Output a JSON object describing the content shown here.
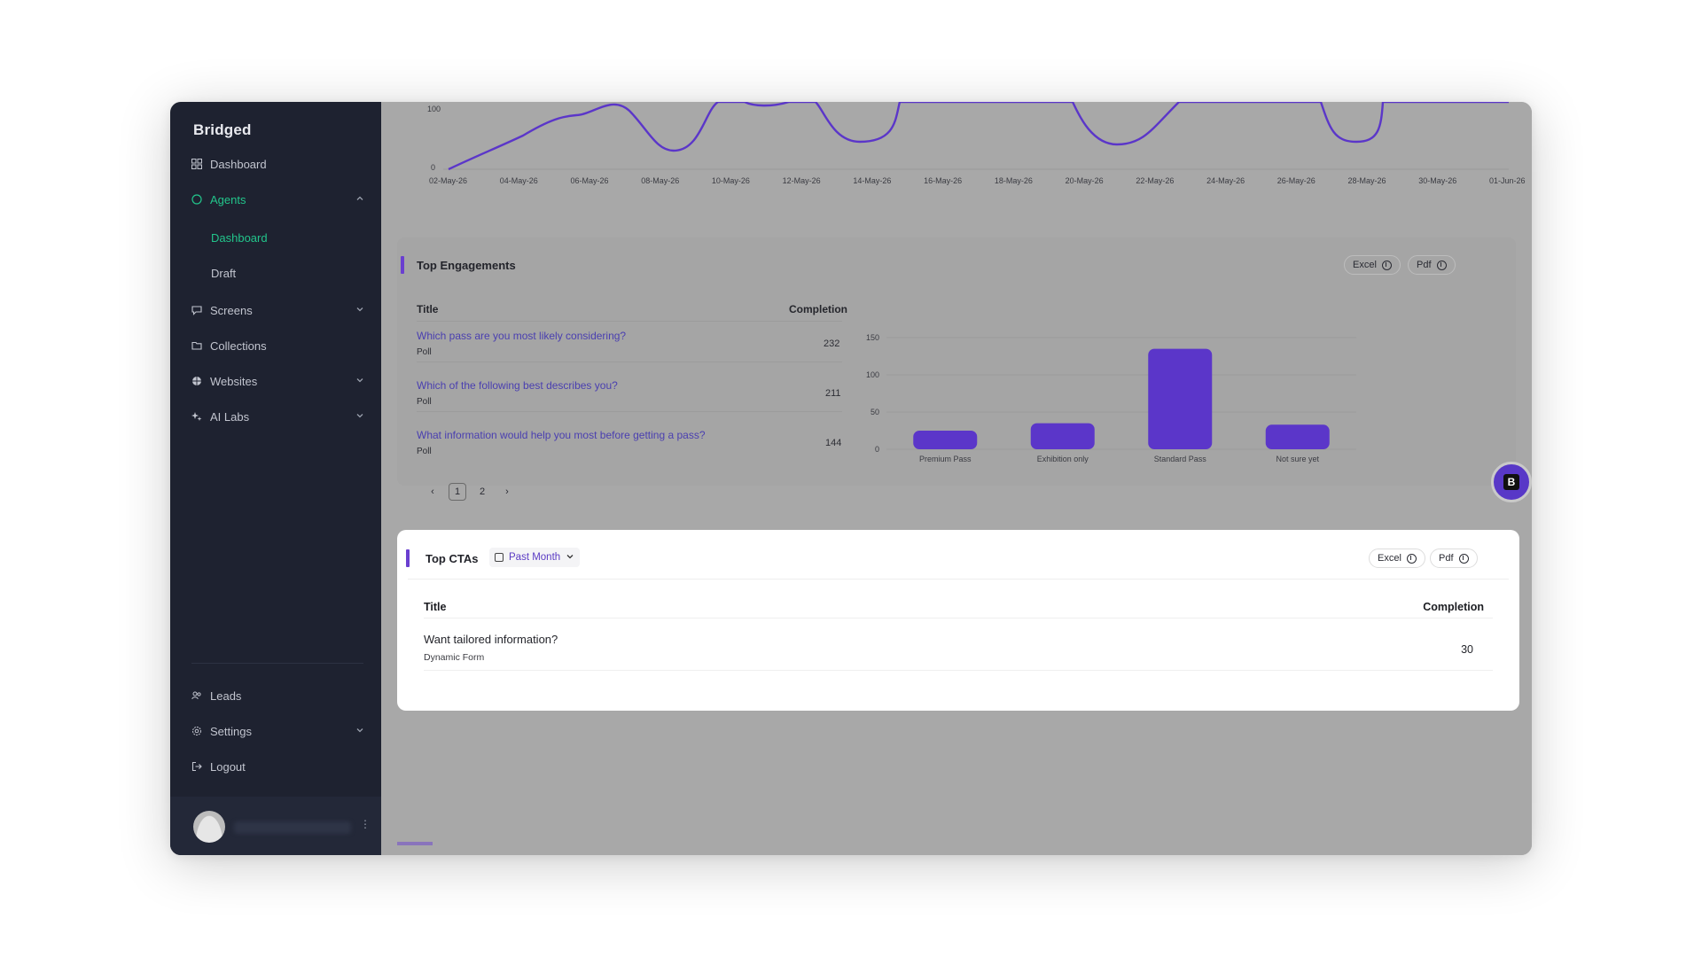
{
  "app": {
    "logo": "Bridged"
  },
  "sidebar": {
    "items": [
      {
        "label": "Dashboard",
        "icon": "grid-icon"
      },
      {
        "label": "Agents",
        "icon": "agents-icon",
        "active": true
      },
      {
        "label": "Dashboard",
        "sub": true,
        "active": true
      },
      {
        "label": "Draft",
        "sub": true
      },
      {
        "label": "Screens",
        "icon": "chat-icon"
      },
      {
        "label": "Collections",
        "icon": "folder-icon"
      },
      {
        "label": "Websites",
        "icon": "globe-icon"
      },
      {
        "label": "AI Labs",
        "icon": "sparkle-icon"
      }
    ],
    "bottom": [
      {
        "label": "Leads",
        "icon": "users-icon"
      },
      {
        "label": "Settings",
        "icon": "gear-icon"
      },
      {
        "label": "Logout",
        "icon": "logout-icon"
      }
    ]
  },
  "line_chart": {
    "y_ticks": [
      "100",
      "0"
    ],
    "x_ticks": [
      "02-May-26",
      "04-May-26",
      "06-May-26",
      "08-May-26",
      "10-May-26",
      "12-May-26",
      "14-May-26",
      "16-May-26",
      "18-May-26",
      "20-May-26",
      "22-May-26",
      "24-May-26",
      "26-May-26",
      "28-May-26",
      "30-May-26",
      "01-Jun-26"
    ]
  },
  "engagements": {
    "title": "Top Engagements",
    "excel_label": "Excel",
    "pdf_label": "Pdf",
    "col_title": "Title",
    "col_completion": "Completion",
    "rows": [
      {
        "title": "Which pass are you most likely considering?",
        "type": "Poll",
        "value": "232"
      },
      {
        "title": "Which of the following best describes you?",
        "type": "Poll",
        "value": "211"
      },
      {
        "title": "What information would help you most before getting a pass?",
        "type": "Poll",
        "value": "144"
      }
    ],
    "pager": {
      "current": "1",
      "next": "2"
    }
  },
  "chart_data": {
    "type": "bar",
    "categories": [
      "Premium Pass",
      "Exhibition only",
      "Standard Pass",
      "Not sure yet"
    ],
    "values": [
      25,
      35,
      135,
      33
    ],
    "ylim": [
      0,
      150
    ],
    "y_ticks": [
      0,
      50,
      100,
      150
    ],
    "color": "#5b36c9"
  },
  "ctas": {
    "title": "Top CTAs",
    "filter": "Past Month",
    "excel_label": "Excel",
    "pdf_label": "Pdf",
    "col_title": "Title",
    "col_completion": "Completion",
    "rows": [
      {
        "title": "Want tailored information?",
        "type": "Dynamic Form",
        "value": "30"
      }
    ]
  },
  "colors": {
    "accent": "#6a3fd0",
    "sidebar_bg": "#1e2230",
    "active_green": "#22c58b"
  }
}
